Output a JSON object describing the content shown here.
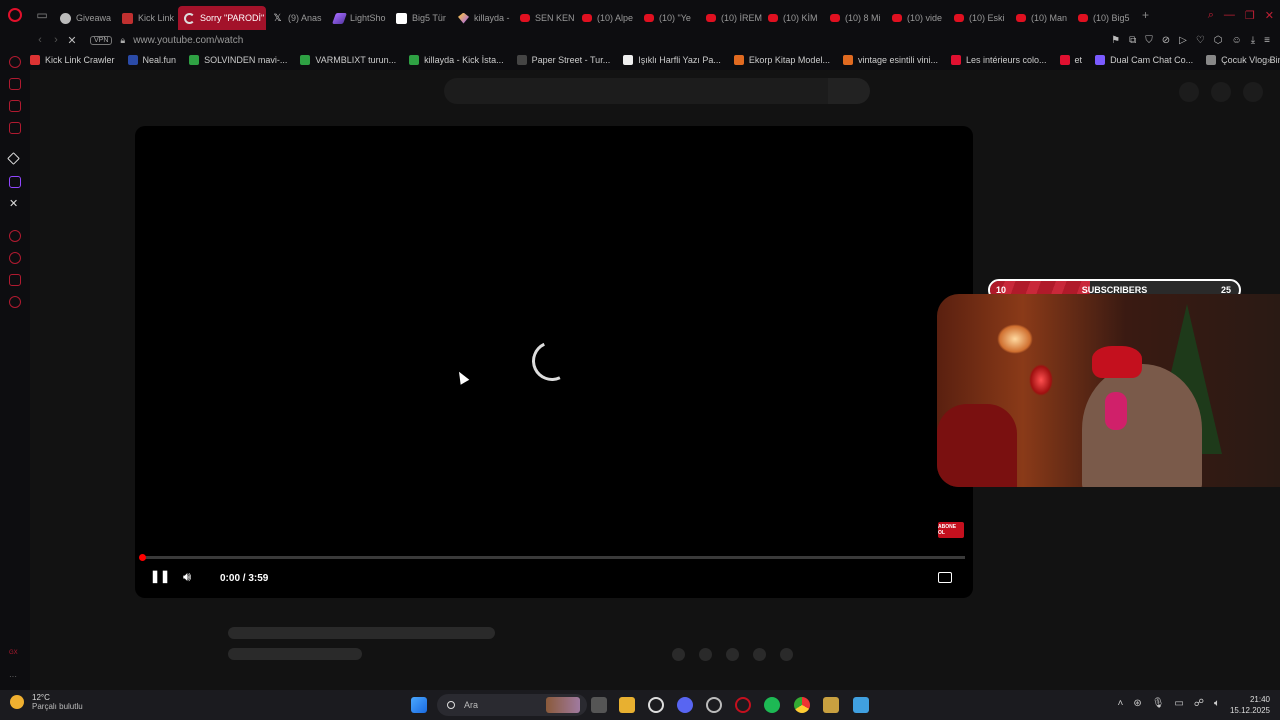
{
  "tabs": [
    {
      "label": "Giveawa",
      "icon": "gear"
    },
    {
      "label": "Kick Link",
      "icon": "kick"
    },
    {
      "label": "Sorry \"PARODİ\" -",
      "icon": "spin",
      "active": true
    },
    {
      "label": "(9) Anas",
      "icon": "x"
    },
    {
      "label": "LightSho",
      "icon": "feather"
    },
    {
      "label": "Big5 Tür",
      "icon": "big5"
    },
    {
      "label": "killayda -",
      "icon": "gem"
    },
    {
      "label": "SEN KEN",
      "icon": "yt"
    },
    {
      "label": "(10) Alpe",
      "icon": "yt"
    },
    {
      "label": "(10) \"Ye",
      "icon": "yt"
    },
    {
      "label": "(10) İREM",
      "icon": "yt"
    },
    {
      "label": "(10) KİM",
      "icon": "yt"
    },
    {
      "label": "(10) 8 Mi",
      "icon": "yt"
    },
    {
      "label": "(10) vide",
      "icon": "yt"
    },
    {
      "label": "(10) Eski",
      "icon": "yt"
    },
    {
      "label": "(10) Man",
      "icon": "yt"
    },
    {
      "label": "(10) Big5",
      "icon": "yt"
    }
  ],
  "address": {
    "vpn": "VPN",
    "url": "www.youtube.com/watch"
  },
  "bookmarks": [
    {
      "label": "Kick Link Crawler",
      "color": "#d33"
    },
    {
      "label": "Neal.fun",
      "color": "#2a4aa8"
    },
    {
      "label": "SOLVINDEN mavi-...",
      "color": "#2ea043"
    },
    {
      "label": "VARMBLIXT turun...",
      "color": "#2ea043"
    },
    {
      "label": "killayda - Kick İsta...",
      "color": "#2ea043"
    },
    {
      "label": "Paper Street - Tur...",
      "color": "#444"
    },
    {
      "label": "Işıklı Harfli Yazı Pa...",
      "color": "#eee"
    },
    {
      "label": "Ekorp Kitap Model...",
      "color": "#e06a20"
    },
    {
      "label": "vintage esintili vini...",
      "color": "#e06a20"
    },
    {
      "label": "Les intérieurs colo...",
      "color": "#e01030"
    },
    {
      "label": "et",
      "color": "#e01030"
    },
    {
      "label": "Dual Cam Chat Co...",
      "color": "#7a5aff"
    },
    {
      "label": "Çocuk Vlog Bingosu",
      "color": "#888"
    }
  ],
  "player": {
    "timestamp": "0:00 / 3:59",
    "subscribe_badge": "ABONE OL",
    "progress_fraction": 0.0
  },
  "subscribers": {
    "current": "10",
    "label": "SUBSCRIBERS",
    "goal": "25",
    "fraction": 0.4
  },
  "taskbar": {
    "temperature": "12°C",
    "condition": "Parçalı bulutlu",
    "search_placeholder": "Ara",
    "time": "21:40",
    "date": "15.12.2025"
  },
  "colors": {
    "accent": "#a3122a",
    "youtube_red": "#ff0000"
  }
}
